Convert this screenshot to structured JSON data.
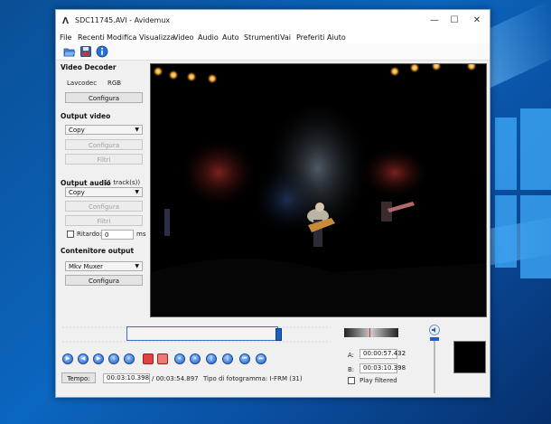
{
  "window": {
    "title": "SDC11745.AVI - Avidemux",
    "minimize_glyph": "—",
    "maximize_glyph": "☐",
    "close_glyph": "✕"
  },
  "menu": [
    "File",
    "Recenti",
    "Modifica",
    "Visualizza",
    "Video",
    "Audio",
    "Auto",
    "Strumenti",
    "Vai",
    "Preferiti",
    "Aiuto"
  ],
  "toolbar": {
    "icons": [
      "open-folder-icon",
      "save-icon",
      "info-icon"
    ]
  },
  "left_panel": {
    "video_decoder": {
      "title": "Video Decoder",
      "codec_label": "Lavcodec",
      "codec_value": "RGB",
      "configure": "Configura"
    },
    "output_video": {
      "title": "Output video",
      "codec": "Copy",
      "configure": "Configura",
      "filters": "Filtri"
    },
    "output_audio": {
      "title": "Output audio",
      "tracks": "(1 track(s))",
      "codec": "Copy",
      "configure": "Configura",
      "filters": "Filtri",
      "delay_label": "Ritardo:",
      "delay_value": "0",
      "delay_unit": "ms"
    },
    "container": {
      "title": "Contenitore output",
      "format": "Mkv Muxer",
      "configure": "Configura"
    }
  },
  "transport": {
    "icons": [
      "play-icon",
      "rewind-icon",
      "forward-icon",
      "prev-frame-icon",
      "next-frame-icon",
      "marker-a-icon",
      "marker-b-icon",
      "prev-black-icon",
      "next-black-icon",
      "prev-keyframe-icon",
      "next-keyframe-icon",
      "first-frame-icon",
      "last-frame-icon"
    ]
  },
  "status": {
    "time_button": "Tempo:",
    "current_time": "00:03:10.398",
    "total_time": "/ 00:03:54.897",
    "frame_type": "Tipo di fotogramma:  I-FRM (31)"
  },
  "markers": {
    "a_label": "A:",
    "a_value": "00:00:57.432",
    "b_label": "B:",
    "b_value": "00:03:10.398",
    "play_filtered": "Play filtered"
  },
  "colors": {
    "accent": "#1f5fc4",
    "window_bg": "#f0f0f0",
    "video_bg": "#000000"
  }
}
